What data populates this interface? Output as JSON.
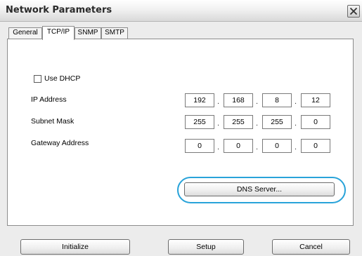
{
  "window": {
    "title": "Network Parameters"
  },
  "tabs": [
    {
      "label": "General"
    },
    {
      "label": "TCP/IP",
      "active": true
    },
    {
      "label": "SNMP"
    },
    {
      "label": "SMTP"
    }
  ],
  "dhcp": {
    "label": "Use DHCP",
    "checked": false
  },
  "fields": {
    "ip": {
      "label": "IP Address",
      "octets": [
        "192",
        "168",
        "8",
        "12"
      ]
    },
    "subnet": {
      "label": "Subnet Mask",
      "octets": [
        "255",
        "255",
        "255",
        "0"
      ]
    },
    "gateway": {
      "label": "Gateway Address",
      "octets": [
        "0",
        "0",
        "0",
        "0"
      ]
    }
  },
  "separator": ".",
  "dns_button": {
    "label": "DNS Server..."
  },
  "footer": {
    "initialize": "Initialize",
    "setup": "Setup",
    "cancel": "Cancel"
  },
  "colors": {
    "highlight": "#29a3d9"
  },
  "icons": {
    "close": "close-icon"
  }
}
